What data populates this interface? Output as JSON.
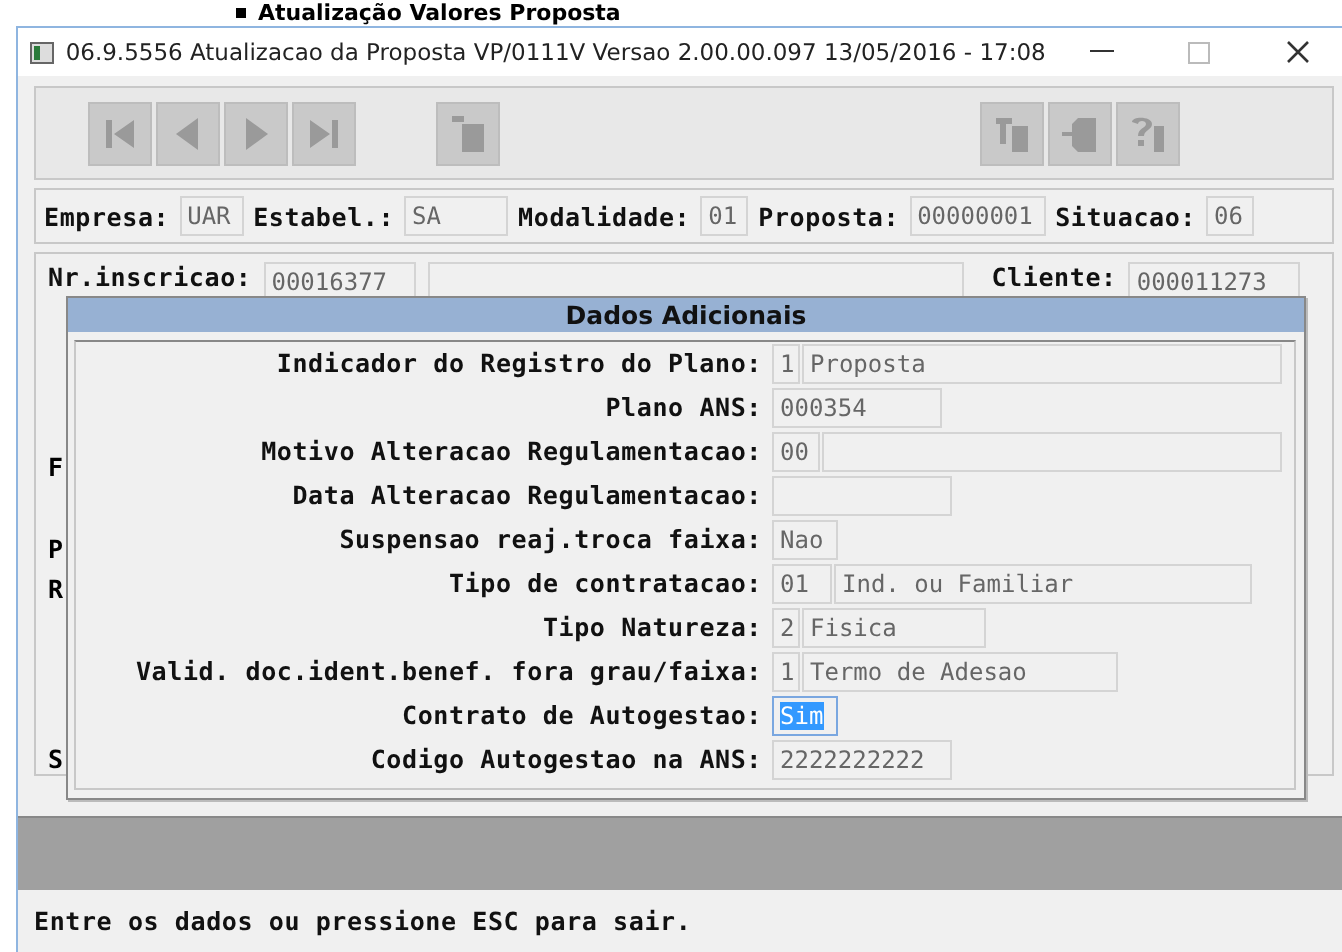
{
  "page_heading": "Atualização Valores Proposta",
  "window": {
    "title": "06.9.5556 Atualizacao da Proposta VP/0111V Versao 2.00.00.097 13/05/2016 - 17:08"
  },
  "header_fields": [
    {
      "label": "Empresa:",
      "value": "UAR"
    },
    {
      "label": "Estabel.:",
      "value": "SA"
    },
    {
      "label": "Modalidade:",
      "value": "01"
    },
    {
      "label": "Proposta:",
      "value": "00000001"
    },
    {
      "label": "Situacao:",
      "value": "06"
    }
  ],
  "form": {
    "nr_inscricao": {
      "label": "Nr.inscricao:",
      "value": "00016377"
    },
    "cliente": {
      "label": "Cliente:",
      "value": "000011273"
    },
    "partial_labels": [
      "F",
      "P",
      "R",
      "S"
    ]
  },
  "dialog": {
    "title": "Dados Adicionais",
    "rows": [
      {
        "label": "Indicador do Registro do Plano:",
        "fields": [
          {
            "value": "1",
            "highlighted": false
          },
          {
            "value": "Proposta",
            "highlighted": false
          }
        ]
      },
      {
        "label": "Plano ANS:",
        "fields": [
          {
            "value": "000354",
            "highlighted": false
          }
        ]
      },
      {
        "label": "Motivo Alteracao Regulamentacao:",
        "fields": [
          {
            "value": "00",
            "highlighted": false
          },
          {
            "highlighted": false
          }
        ]
      },
      {
        "label": "Data Alteracao Regulamentacao:",
        "fields": [
          {
            "highlighted": false
          }
        ]
      },
      {
        "label": "Suspensao reaj.troca faixa:",
        "fields": [
          {
            "value": "Nao",
            "highlighted": false
          }
        ]
      },
      {
        "label": "Tipo de contratacao:",
        "fields": [
          {
            "value": "01",
            "highlighted": false
          },
          {
            "value": "Ind. ou Familiar",
            "highlighted": false
          }
        ]
      },
      {
        "label": "Tipo Natureza:",
        "fields": [
          {
            "value": "2",
            "highlighted": false
          },
          {
            "value": "Fisica",
            "highlighted": false
          }
        ]
      },
      {
        "label": "Valid. doc.ident.benef. fora grau/faixa:",
        "fields": [
          {
            "value": "1",
            "highlighted": false
          },
          {
            "value": "Termo de Adesao",
            "highlighted": false
          }
        ]
      },
      {
        "label": "Contrato de Autogestao:",
        "fields": [
          {
            "value": "Sim",
            "highlighted": true
          }
        ]
      },
      {
        "label": "Codigo Autogestao na ANS:",
        "fields": [
          {
            "value": "2222222222",
            "highlighted": false
          }
        ]
      }
    ]
  },
  "status_bar": {
    "text": "Entre os dados ou pressione ESC para sair."
  }
}
